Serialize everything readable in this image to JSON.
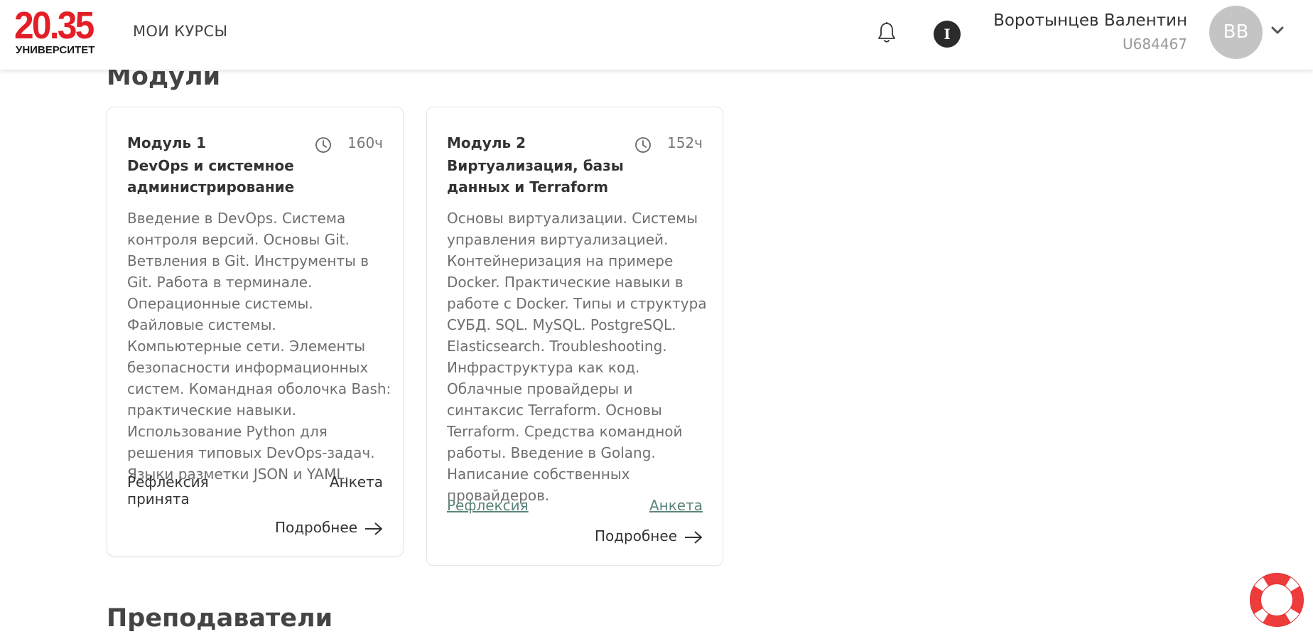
{
  "header": {
    "logo_number": "20.35",
    "logo_text": "УНИВЕРСИТЕТ",
    "nav_my_courses": "МОИ КУРСЫ",
    "info_label": "I",
    "user_name": "Воротынцев Валентин",
    "user_id": "U684467",
    "avatar_initials": "ВВ"
  },
  "sections": {
    "modules_title": "Модули",
    "teachers_title": "Преподаватели"
  },
  "modules": [
    {
      "label": "Модуль 1",
      "title": "DevOps и системное администрирование",
      "hours": "160ч",
      "description": "Введение в DevOps. Система контроля версий. Основы Git. Ветвления в Git. Инструменты в Git. Работа в терминале. Операционные системы. Файловые системы. Компьютерные сети. Элементы безопасности информационных систем. Командная оболочка Bash: практические навыки. Использование Python для решения типовых DevOps-задач. Языки разметки JSON и YAML.",
      "reflection": "Рефлексия принята",
      "survey": "Анкета",
      "more": "Подробнее"
    },
    {
      "label": "Модуль 2",
      "title": "Виртуализация, базы данных и Terraform",
      "hours": "152ч",
      "description": "Основы виртуализации. Системы управления виртуализацией. Контейнеризация на примере Docker. Практические навыки в работе с Docker. Типы и структура СУБД. SQL. MySQL. PostgreSQL. Elasticsearch. Troubleshooting. Инфраструктура как код. Облачные провайдеры и синтаксис Terraform. Основы Terraform. Средства командной работы. Введение в Golang. Написание собственных провайдеров.",
      "reflection": "Рефлексия",
      "survey": "Анкета",
      "more": "Подробнее"
    }
  ],
  "colors": {
    "brand_red": "#e41e26",
    "link_green": "#5b8479",
    "avatar_gray": "#c4c4c4"
  },
  "icons": [
    "bell-icon",
    "info-icon",
    "chevron-down-icon",
    "clock-icon",
    "arrow-right-icon",
    "lifebuoy-icon"
  ]
}
